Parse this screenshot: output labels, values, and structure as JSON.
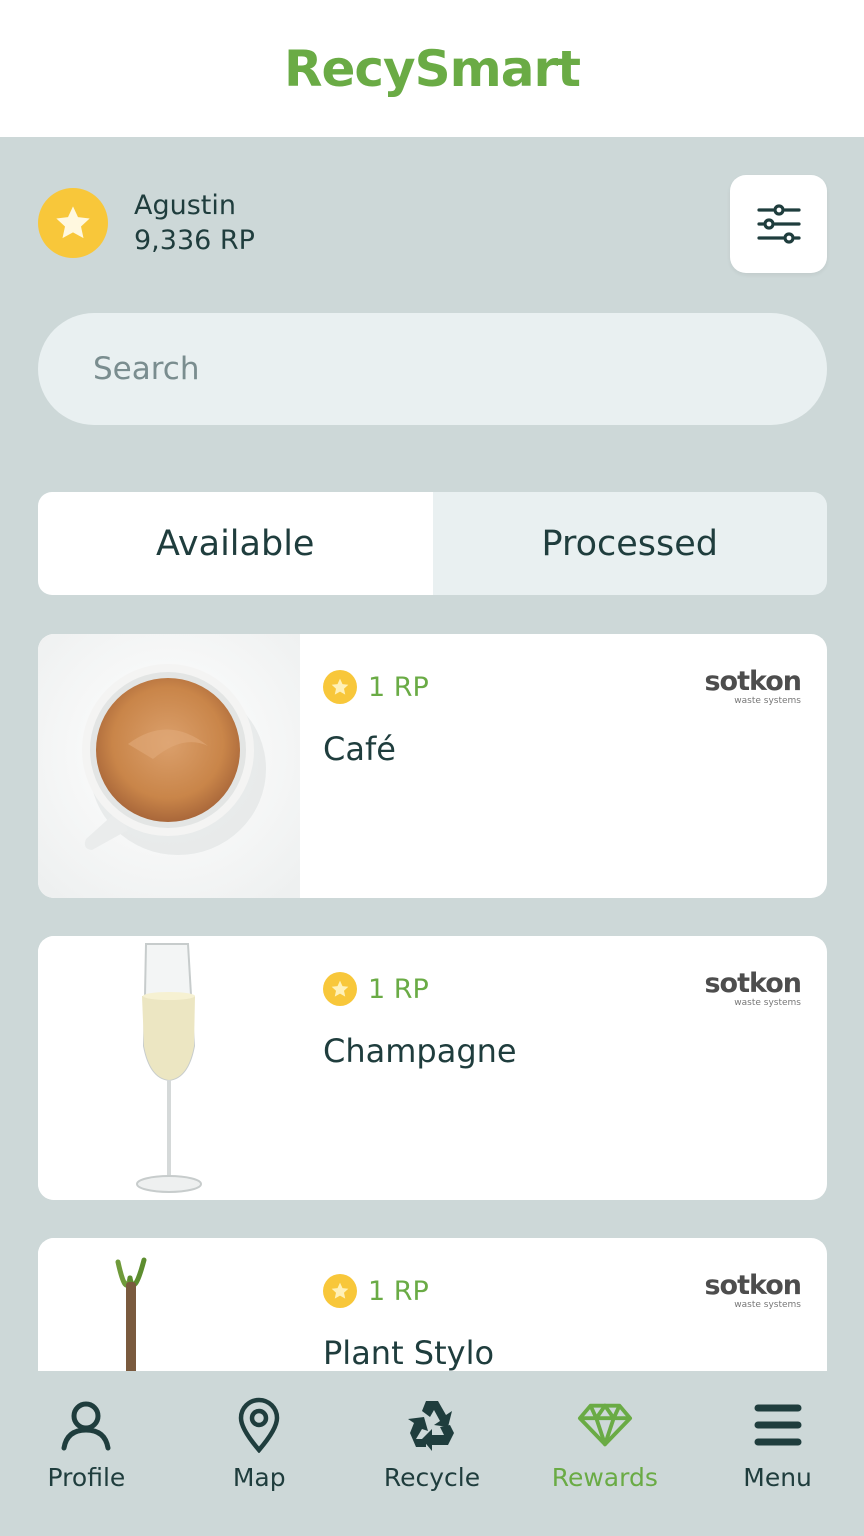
{
  "header": {
    "app_name": "RecySmart"
  },
  "user": {
    "name": "Agustin",
    "points": "9,336 RP"
  },
  "search": {
    "placeholder": "Search"
  },
  "tabs": [
    {
      "label": "Available",
      "active": true
    },
    {
      "label": "Processed",
      "active": false
    }
  ],
  "items": [
    {
      "points": "1 RP",
      "title": "Café",
      "brand": "sotkon",
      "brand_sub": "waste systems",
      "image": "coffee-cup"
    },
    {
      "points": "1 RP",
      "title": "Champagne",
      "brand": "sotkon",
      "brand_sub": "waste systems",
      "image": "champagne-glass"
    },
    {
      "points": "1 RP",
      "title": "Plant Stylo",
      "brand": "sotkon",
      "brand_sub": "waste systems",
      "image": "plant-pencil"
    }
  ],
  "nav": [
    {
      "label": "Profile",
      "icon": "user-icon"
    },
    {
      "label": "Map",
      "icon": "map-pin-icon"
    },
    {
      "label": "Recycle",
      "icon": "recycle-icon"
    },
    {
      "label": "Rewards",
      "icon": "diamond-icon",
      "active": true
    },
    {
      "label": "Menu",
      "icon": "hamburger-icon"
    }
  ],
  "colors": {
    "accent": "#6aab45",
    "background": "#cdd8d8",
    "text": "#1f3d3d",
    "star": "#f8c73a"
  }
}
